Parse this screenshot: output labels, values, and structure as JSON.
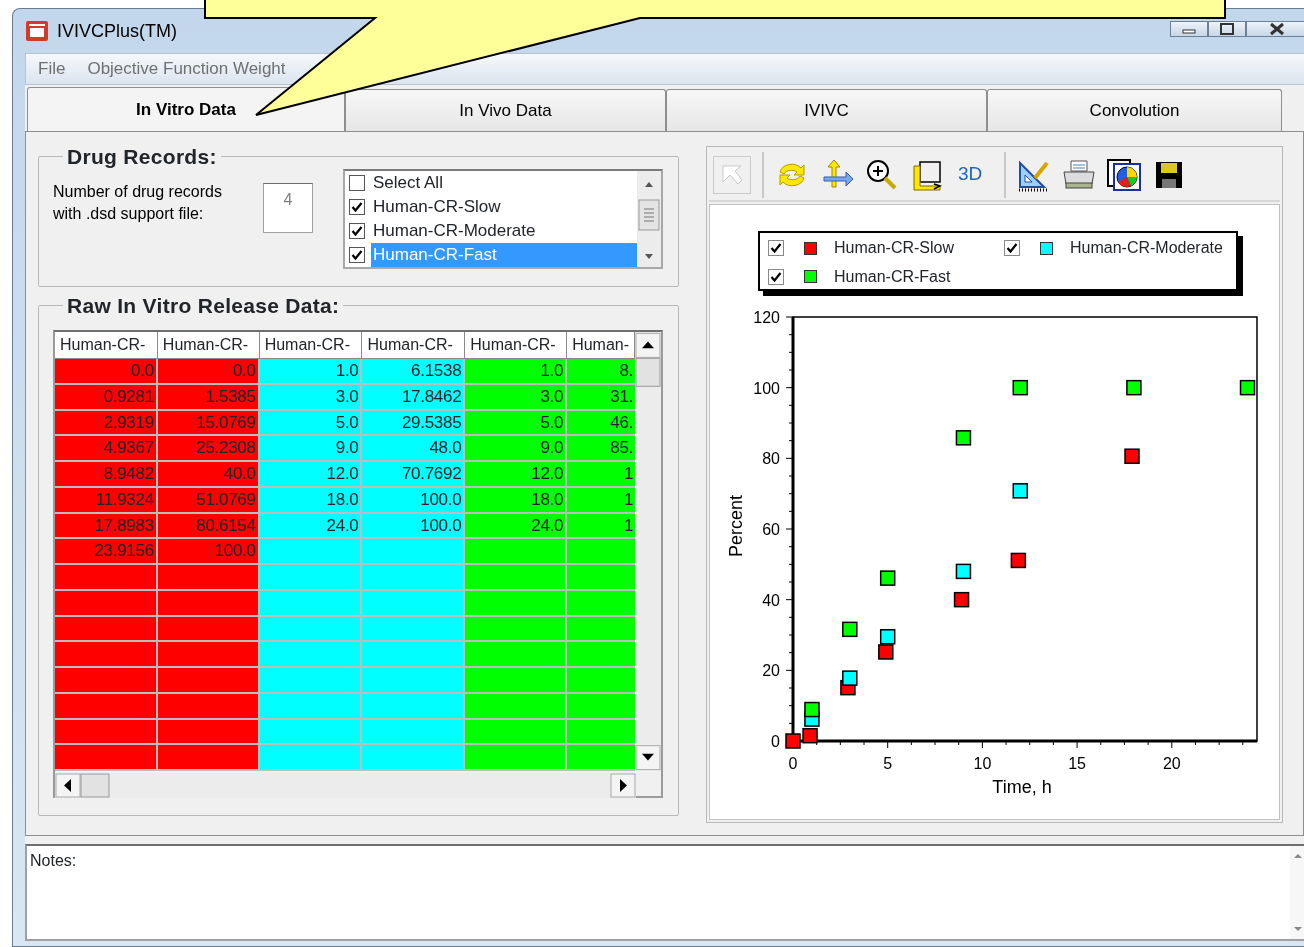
{
  "window": {
    "title": "IVIVCPlus(TM)"
  },
  "menu": [
    "File",
    "Objective Function Weight"
  ],
  "tabs": [
    {
      "label": "In Vitro Data",
      "selected": true
    },
    {
      "label": "In Vivo Data",
      "selected": false
    },
    {
      "label": "IVIVC",
      "selected": false
    },
    {
      "label": "Convolution",
      "selected": false
    }
  ],
  "drug_records": {
    "title": "Drug Records:",
    "count_label": "Number of drug records with .dsd support file:",
    "count": {
      "value": "4",
      "disabled": true
    },
    "list": [
      {
        "label": "Select All",
        "checked": false,
        "selected": false
      },
      {
        "label": "Human-CR-Slow",
        "checked": true,
        "selected": false
      },
      {
        "label": "Human-CR-Moderate",
        "checked": true,
        "selected": false
      },
      {
        "label": "Human-CR-Fast",
        "checked": true,
        "selected": true
      }
    ]
  },
  "raw_data": {
    "title": "Raw In Vitro Release Data:",
    "columns": [
      {
        "header": "Human-CR-",
        "color": "#ff0000"
      },
      {
        "header": "Human-CR-",
        "color": "#ff0000"
      },
      {
        "header": "Human-CR-",
        "color": "#00ffff"
      },
      {
        "header": "Human-CR-",
        "color": "#00ffff"
      },
      {
        "header": "Human-CR-",
        "color": "#00ff00"
      },
      {
        "header": "Human-",
        "color": "#00ff00"
      }
    ],
    "rows": [
      [
        "0.0",
        "0.0",
        "1.0",
        "6.1538",
        "1.0",
        "8."
      ],
      [
        "0.9281",
        "1.5385",
        "3.0",
        "17.8462",
        "3.0",
        "31."
      ],
      [
        "2.9319",
        "15.0769",
        "5.0",
        "29.5385",
        "5.0",
        "46."
      ],
      [
        "4.9367",
        "25.2308",
        "9.0",
        "48.0",
        "9.0",
        "85."
      ],
      [
        "8.9482",
        "40.0",
        "12.0",
        "70.7692",
        "12.0",
        "1"
      ],
      [
        "11.9324",
        "51.0769",
        "18.0",
        "100.0",
        "18.0",
        "1"
      ],
      [
        "17.8983",
        "80.6154",
        "24.0",
        "100.0",
        "24.0",
        "1"
      ],
      [
        "23.9156",
        "100.0"
      ]
    ]
  },
  "chart": {
    "toolbar": {
      "pointer_disabled": true,
      "label_3d": "3D"
    },
    "legend_checks": [
      {
        "checked": true
      },
      {
        "checked": true
      },
      {
        "checked": true
      }
    ],
    "chart_data": {
      "type": "scatter",
      "legend": "top",
      "xlabel": "Time, h",
      "ylabel": "Percent",
      "xlim": [
        0,
        24.5
      ],
      "ylim": [
        0,
        120
      ],
      "xticks": [
        0,
        5,
        10,
        15,
        20
      ],
      "yticks": [
        0,
        20,
        40,
        60,
        80,
        100,
        120
      ],
      "series": [
        {
          "name": "Human-CR-Slow",
          "color": "#ff0000",
          "x": [
            0,
            0.9,
            2.9,
            4.9,
            8.9,
            11.9,
            17.9
          ],
          "values": [
            0,
            1.5,
            15.1,
            25.2,
            40,
            51.1,
            80.6
          ]
        },
        {
          "name": "Human-CR-Moderate",
          "color": "#00ffff",
          "x": [
            1,
            3,
            5,
            9,
            12
          ],
          "values": [
            6.2,
            17.8,
            29.5,
            48,
            70.8
          ]
        },
        {
          "name": "Human-CR-Fast",
          "color": "#00ff00",
          "x": [
            1,
            3,
            5,
            9,
            12,
            18,
            24
          ],
          "values": [
            8.9,
            31.6,
            46.1,
            85.8,
            100,
            100,
            100
          ]
        }
      ]
    }
  },
  "notes": {
    "label": "Notes:"
  }
}
